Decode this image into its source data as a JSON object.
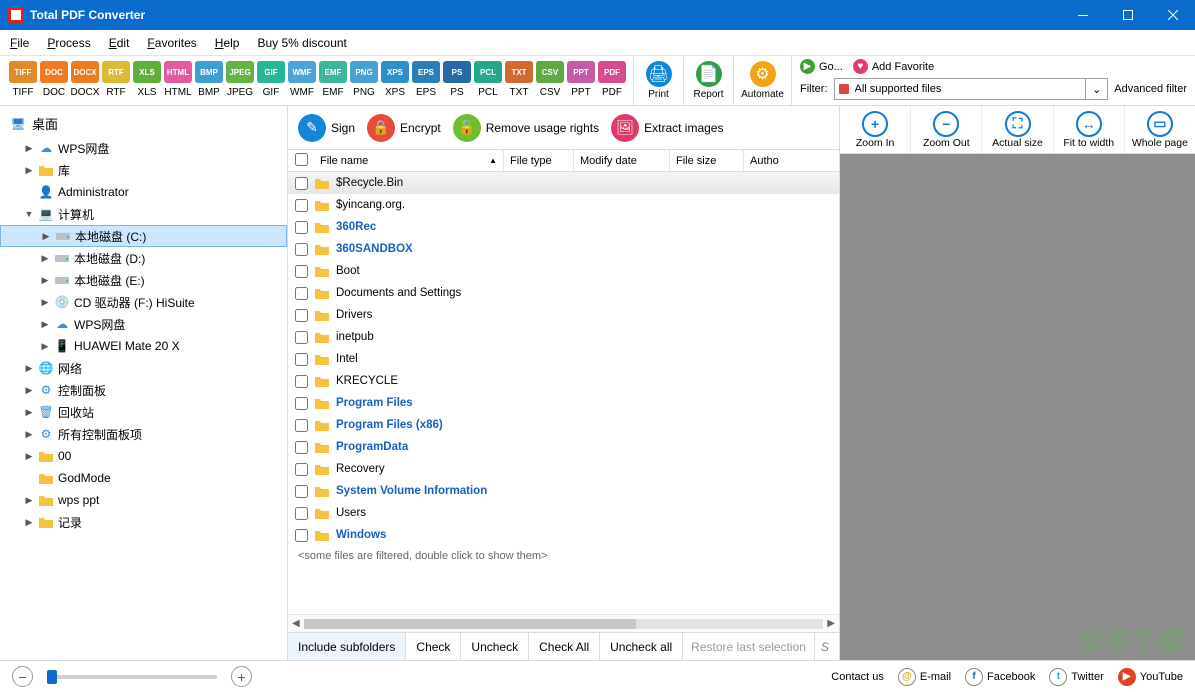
{
  "titlebar": {
    "title": "Total PDF Converter"
  },
  "menu": {
    "file": "File",
    "process": "Process",
    "edit": "Edit",
    "favorites": "Favorites",
    "help": "Help",
    "discount": "Buy 5% discount"
  },
  "formats": [
    {
      "key": "TIFF",
      "color": "#e08a2b"
    },
    {
      "key": "DOC",
      "color": "#ef7a1f"
    },
    {
      "key": "DOCX",
      "color": "#ef7a1f"
    },
    {
      "key": "RTF",
      "color": "#dbbb35"
    },
    {
      "key": "XLS",
      "color": "#5fae3b"
    },
    {
      "key": "HTML",
      "color": "#e35a9e"
    },
    {
      "key": "BMP",
      "color": "#3f9dcf"
    },
    {
      "key": "JPEG",
      "color": "#63b445"
    },
    {
      "key": "GIF",
      "color": "#29b59a"
    },
    {
      "key": "WMF",
      "color": "#4da2d8"
    },
    {
      "key": "EMF",
      "color": "#3db79c"
    },
    {
      "key": "PNG",
      "color": "#49a0d2"
    },
    {
      "key": "XPS",
      "color": "#2d8fca"
    },
    {
      "key": "EPS",
      "color": "#2a7fb8"
    },
    {
      "key": "PS",
      "color": "#2669a3"
    },
    {
      "key": "PCL",
      "color": "#26a88f"
    },
    {
      "key": "TXT",
      "color": "#d06a31"
    },
    {
      "key": "CSV",
      "color": "#5ea945"
    },
    {
      "key": "PPT",
      "color": "#c75aa8"
    },
    {
      "key": "PDF",
      "color": "#d94b8f"
    }
  ],
  "bigbtns": {
    "print": "Print",
    "report": "Report",
    "automate": "Automate"
  },
  "filter": {
    "go": "Go...",
    "addfav": "Add Favorite",
    "label": "Filter:",
    "value": "All supported files",
    "adv": "Advanced filter"
  },
  "actions": {
    "sign": "Sign",
    "encrypt": "Encrypt",
    "remove": "Remove usage rights",
    "extract": "Extract images"
  },
  "cols": {
    "name": "File name",
    "type": "File type",
    "modify": "Modify date",
    "size": "File size",
    "author": "Autho"
  },
  "tree": {
    "root": "桌面",
    "items": [
      {
        "id": "wps-cloud",
        "label": "WPS网盘",
        "indent": 1,
        "tw": "▶",
        "icon": "cloud"
      },
      {
        "id": "library",
        "label": "库",
        "indent": 1,
        "tw": "▶",
        "icon": "folder"
      },
      {
        "id": "admin",
        "label": "Administrator",
        "indent": 1,
        "tw": "",
        "icon": "user"
      },
      {
        "id": "computer",
        "label": "计算机",
        "indent": 1,
        "tw": "▼",
        "icon": "computer"
      },
      {
        "id": "drive-c",
        "label": "本地磁盘 (C:)",
        "indent": 2,
        "tw": "▶",
        "icon": "drive",
        "sel": true
      },
      {
        "id": "drive-d",
        "label": "本地磁盘 (D:)",
        "indent": 2,
        "tw": "▶",
        "icon": "drive"
      },
      {
        "id": "drive-e",
        "label": "本地磁盘 (E:)",
        "indent": 2,
        "tw": "▶",
        "icon": "drive"
      },
      {
        "id": "cd-f",
        "label": "CD 驱动器 (F:) HiSuite",
        "indent": 2,
        "tw": "▶",
        "icon": "cd"
      },
      {
        "id": "wps-cloud2",
        "label": "WPS网盘",
        "indent": 2,
        "tw": "▶",
        "icon": "cloud"
      },
      {
        "id": "huawei",
        "label": "HUAWEI Mate 20 X",
        "indent": 2,
        "tw": "▶",
        "icon": "phone"
      },
      {
        "id": "network",
        "label": "网络",
        "indent": 1,
        "tw": "▶",
        "icon": "network"
      },
      {
        "id": "control",
        "label": "控制面板",
        "indent": 1,
        "tw": "▶",
        "icon": "control"
      },
      {
        "id": "recycle",
        "label": "回收站",
        "indent": 1,
        "tw": "▶",
        "icon": "recycle"
      },
      {
        "id": "allcontrol",
        "label": "所有控制面板项",
        "indent": 1,
        "tw": "▶",
        "icon": "control"
      },
      {
        "id": "zz",
        "label": "00",
        "indent": 1,
        "tw": "▶",
        "icon": "folder"
      },
      {
        "id": "godmode",
        "label": "GodMode",
        "indent": 1,
        "tw": "",
        "icon": "folder"
      },
      {
        "id": "wpsppt",
        "label": "wps ppt",
        "indent": 1,
        "tw": "▶",
        "icon": "folder"
      },
      {
        "id": "jilu",
        "label": "记录",
        "indent": 1,
        "tw": "▶",
        "icon": "folder"
      }
    ]
  },
  "files": [
    {
      "name": "$Recycle.Bin",
      "sys": false,
      "sel": true
    },
    {
      "name": "$yincang.org.",
      "sys": false
    },
    {
      "name": "360Rec",
      "sys": true
    },
    {
      "name": "360SANDBOX",
      "sys": true
    },
    {
      "name": "Boot",
      "sys": false
    },
    {
      "name": "Documents and Settings",
      "sys": false
    },
    {
      "name": "Drivers",
      "sys": false
    },
    {
      "name": "inetpub",
      "sys": false
    },
    {
      "name": "Intel",
      "sys": false
    },
    {
      "name": "KRECYCLE",
      "sys": false
    },
    {
      "name": "Program Files",
      "sys": true
    },
    {
      "name": "Program Files (x86)",
      "sys": true
    },
    {
      "name": "ProgramData",
      "sys": true
    },
    {
      "name": "Recovery",
      "sys": false
    },
    {
      "name": "System Volume Information",
      "sys": true
    },
    {
      "name": "Users",
      "sys": false
    },
    {
      "name": "Windows",
      "sys": true
    }
  ],
  "filtered_note": "<some files are filtered, double click to show them>",
  "tabs": {
    "include": "Include subfolders",
    "check": "Check",
    "uncheck": "Uncheck",
    "checkall": "Check All",
    "uncheckall": "Uncheck all",
    "restore": "Restore last selection",
    "search": "S"
  },
  "zoom": {
    "in": "Zoom In",
    "out": "Zoom Out",
    "actual": "Actual size",
    "fit": "Fit to width",
    "whole": "Whole page"
  },
  "status": {
    "contact": "Contact us",
    "email": "E-mail",
    "fb": "Facebook",
    "tw": "Twitter",
    "yt": "YouTube"
  },
  "watermark": "宝哥下载"
}
